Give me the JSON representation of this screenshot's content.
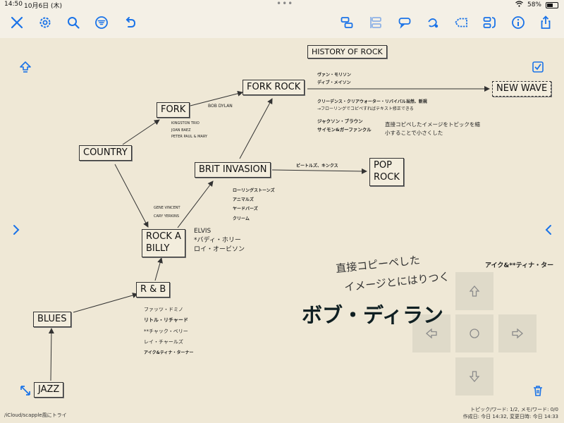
{
  "status": {
    "time": "14:50",
    "date": "10月6日 (木)",
    "battery": "58%",
    "battery_level": 0.58
  },
  "toolbar": {
    "left": [
      "close-icon",
      "gear-icon",
      "search-icon",
      "filter-icon",
      "undo-icon"
    ],
    "right": [
      "border-icon",
      "align-icon",
      "note-icon",
      "connect-icon",
      "tag-icon",
      "spread-icon",
      "info-icon",
      "share-icon"
    ]
  },
  "map": {
    "title": "HISTORY OF ROCK",
    "nodes": {
      "jazz": "JAZZ",
      "blues": "BLUES",
      "rnb": "R & B",
      "rockabilly_line1": "ROCK A",
      "rockabilly_line2": "BILLY",
      "country": "COUNTRY",
      "fork": "FORK",
      "brit": "BRIT INVASION",
      "forkrock": "FORK ROCK",
      "newwave": "NEW WAVE",
      "pop_line1": "POP",
      "pop_line2": "ROCK"
    },
    "notes": {
      "bob_dylan": "BOB DYLAN",
      "fork_artists": [
        "KINGSTON TRIO",
        "JOAN BAEZ",
        "PETER PAUL & MARY"
      ],
      "gene": [
        "GENE VINCENT",
        "CARY YERKINS"
      ],
      "elvis": [
        "ELVIS",
        "*バディ・ホリー",
        "ロイ・オービソン"
      ],
      "brit_artists": [
        "ローリングストーンズ",
        "アニマルズ",
        "ヤードバーズ",
        "クリーム"
      ],
      "beatles": "ビートルズ、キンクス",
      "forkrock_artists": [
        "ヴァン・モリソン",
        "ディブ・メイソン"
      ],
      "ccr": [
        "クリーデンス・クリアウォーター・リバイバル当然、新規",
        "→フローリングでコピペすればテキスト修正できる"
      ],
      "jackson": [
        "ジャクソン・ブラウン",
        "サイモン&ガーファンクル"
      ],
      "direct_copy": [
        "直接コピペしたイメージをトピックを縮",
        "小することで小さくした"
      ],
      "rnb_artists": [
        "ファッツ・ドミノ",
        "リトル・リチャード",
        "**チャック・ベリー",
        "レイ・チャールズ",
        "アイク&ティナ・ターナー"
      ],
      "ike_right": "アイク&**ティナ・ター"
    },
    "handwriting": [
      "直接コピーペした",
      "イメージとにはりつく"
    ],
    "big_title": "ボブ・ディラン"
  },
  "footer": {
    "path": "/iCloud/scapple風にトライ",
    "stats": "トピック/ワード: 1/2, メモ/ワード: 0/0",
    "dates": "作成日: 今日 14:32, 変更日時: 今日 14:33"
  }
}
